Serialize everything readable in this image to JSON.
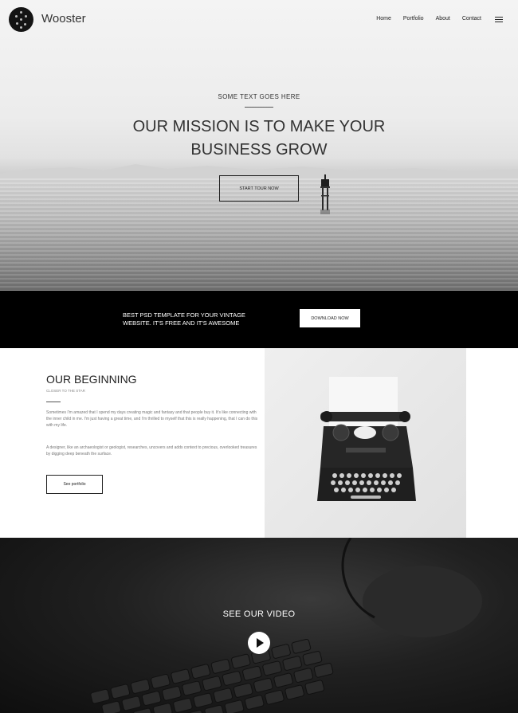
{
  "brand": {
    "name": "Wooster",
    "logo_icon": "logo-dots-icon"
  },
  "nav": {
    "items": [
      "Home",
      "Portfolio",
      "About",
      "Contact"
    ],
    "menu_icon": "hamburger-icon"
  },
  "hero": {
    "kicker": "SOME TEXT GOES HERE",
    "title_line1": "OUR MISSION IS TO MAKE YOUR",
    "title_line2": "BUSINESS GROW",
    "button": "START TOUR NOW"
  },
  "band": {
    "text_line1": "BEST PSD TEMPLATE FOR YOUR VINTAGE",
    "text_line2": "WEBSITE. IT'S FREE AND IT'S AWESOME",
    "button": "DOWNLOAD NOW"
  },
  "about": {
    "title": "OUR BEGINNING",
    "subtitle": "CLOSER TO THE STAR",
    "paragraph1": "Sometimes I'm amazed that I spend my days creating magic and fantasy and that people buy it. It's like connecting with the inner child in me. I'm just having a great time, and I'm thrilled to myself that this is really happening, that I can do this with my life.",
    "paragraph2": "A designer, like an archaeologist or geologist, researches, uncovers and adds context to precious, overlooked treasures by digging deep beneath the surface.",
    "button": "See portfolio"
  },
  "video": {
    "title": "SEE OUR VIDEO",
    "play_icon": "play-icon"
  },
  "colors": {
    "dark": "#000000",
    "text": "#222222",
    "muted": "#777777",
    "white": "#ffffff"
  }
}
